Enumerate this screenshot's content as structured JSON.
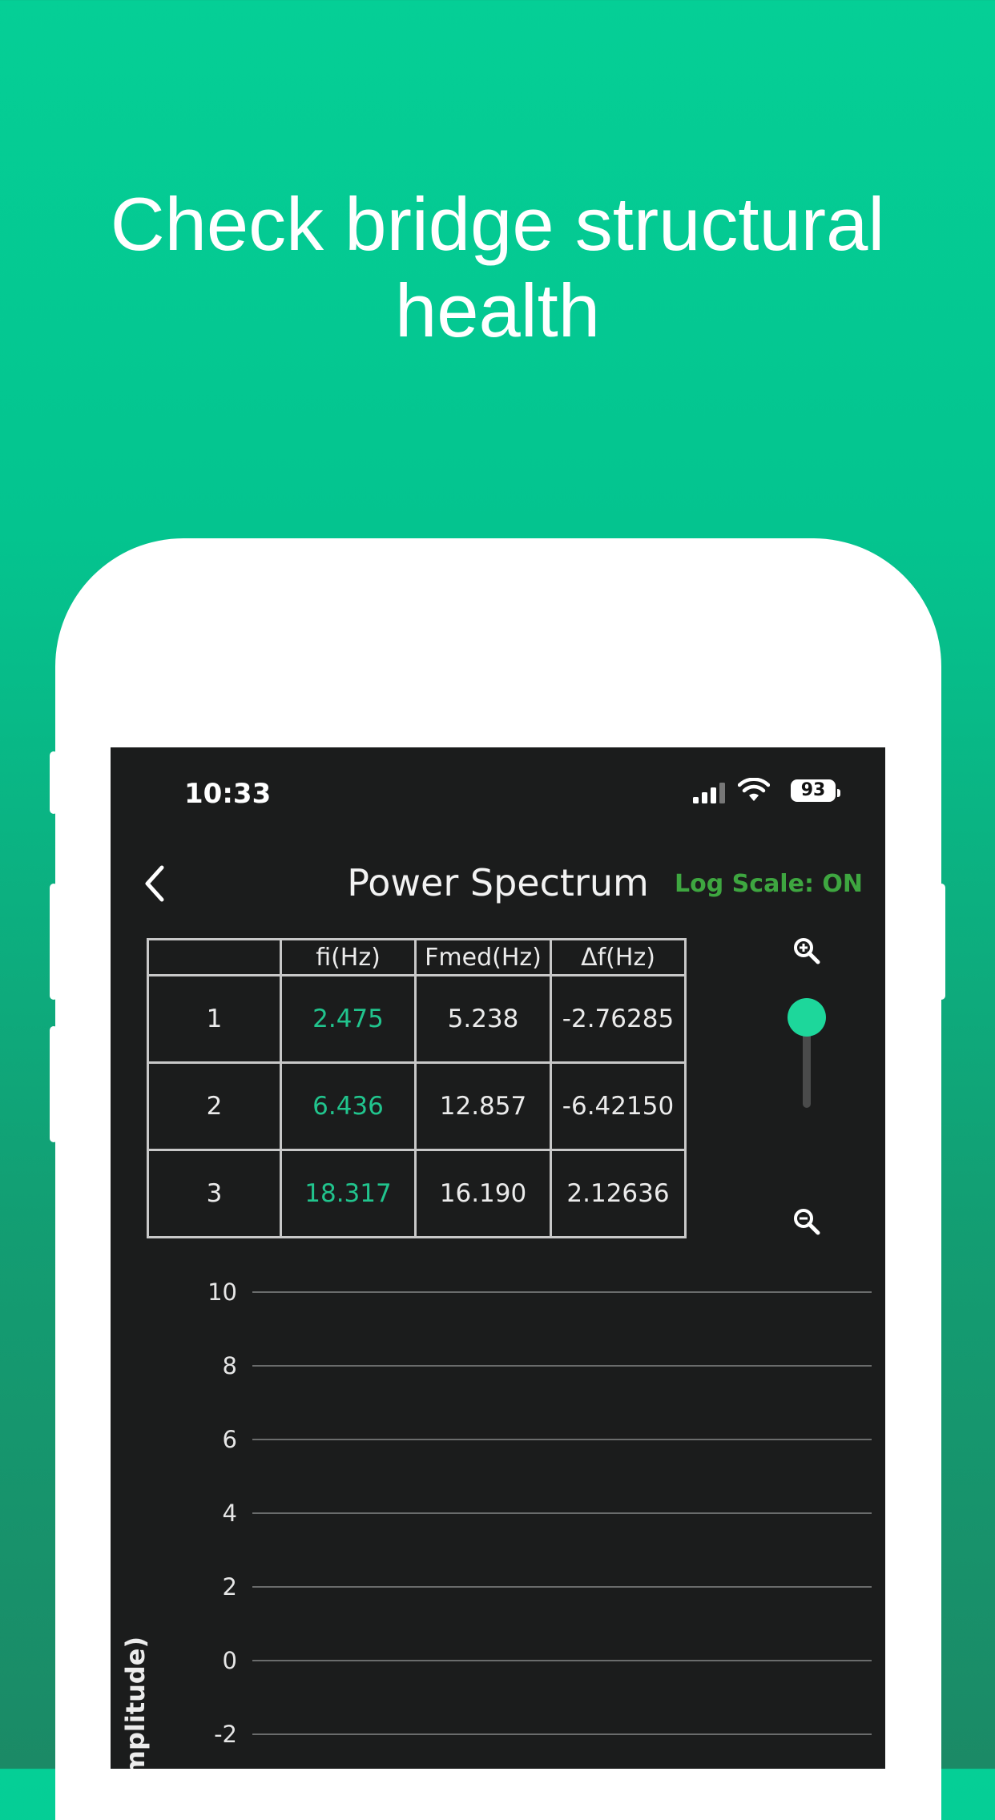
{
  "headline": {
    "line1": "Check bridge structural",
    "line2": "health"
  },
  "status_bar": {
    "time": "10:33",
    "battery": "93"
  },
  "nav": {
    "title": "Power Spectrum",
    "log_scale": "Log Scale: ON"
  },
  "table": {
    "headers": [
      "",
      "fi(Hz)",
      "Fmed(Hz)",
      "Δf(Hz)"
    ],
    "rows": [
      [
        "1",
        "2.475",
        "5.238",
        "-2.76285"
      ],
      [
        "2",
        "6.436",
        "12.857",
        "-6.42150"
      ],
      [
        "3",
        "18.317",
        "16.190",
        "2.12636"
      ]
    ]
  },
  "zoom_slider": {
    "level": 1.0
  },
  "colors": {
    "accent": "#1dd79b",
    "log_scale": "#3ea640",
    "fi_value": "#21c48d",
    "screen_bg": "#1b1c1c"
  },
  "chart_data": {
    "type": "line",
    "ylabel": "Amplitude)",
    "y_ticks": [
      "10",
      "8",
      "6",
      "4",
      "2",
      "0",
      "-2"
    ],
    "ylim": [
      -2,
      10
    ],
    "grid": true,
    "series": []
  }
}
